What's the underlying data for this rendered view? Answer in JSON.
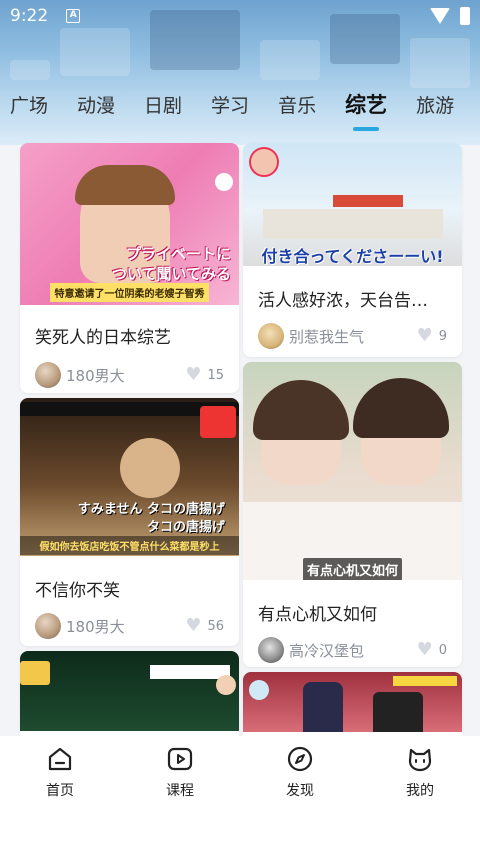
{
  "status_bar": {
    "time": "9:22",
    "notification_letter": "A"
  },
  "tabs": [
    {
      "label": "广场"
    },
    {
      "label": "动漫"
    },
    {
      "label": "日剧"
    },
    {
      "label": "学习"
    },
    {
      "label": "音乐"
    },
    {
      "label": "综艺",
      "active": true
    },
    {
      "label": "旅游"
    }
  ],
  "accent_color": "#2aa6e0",
  "feed": {
    "cards": [
      {
        "title": "笑死人的日本综艺",
        "author": "180男大",
        "likes": "15",
        "thumb_text": [
          "プライベートに",
          "ついて聞いてみる",
          "特意邀请了一位阴柔的老嫂子智秀"
        ]
      },
      {
        "title": "活人感好浓，天台告…",
        "author": "别惹我生气",
        "likes": "9",
        "thumb_text": [
          "付き合ってくださーーい!"
        ]
      },
      {
        "title": "不信你不笑",
        "author": "180男大",
        "likes": "56",
        "thumb_text": [
          "すみません タコの唐揚げ",
          "タコの唐揚げ",
          "假如你去饭店吃饭不管点什么菜都是秒上"
        ]
      },
      {
        "title": "有点心机又如何",
        "author": "高冷汉堡包",
        "likes": "0",
        "thumb_text": [
          "有点心机又如何"
        ]
      },
      {
        "title": "",
        "author": "",
        "likes": "",
        "thumb_text": []
      },
      {
        "title": "",
        "author": "",
        "likes": "",
        "thumb_text": []
      }
    ]
  },
  "bottom_nav": [
    {
      "label": "首页",
      "icon": "home-icon"
    },
    {
      "label": "课程",
      "icon": "play-icon"
    },
    {
      "label": "发现",
      "icon": "compass-icon"
    },
    {
      "label": "我的",
      "icon": "cat-icon"
    }
  ]
}
